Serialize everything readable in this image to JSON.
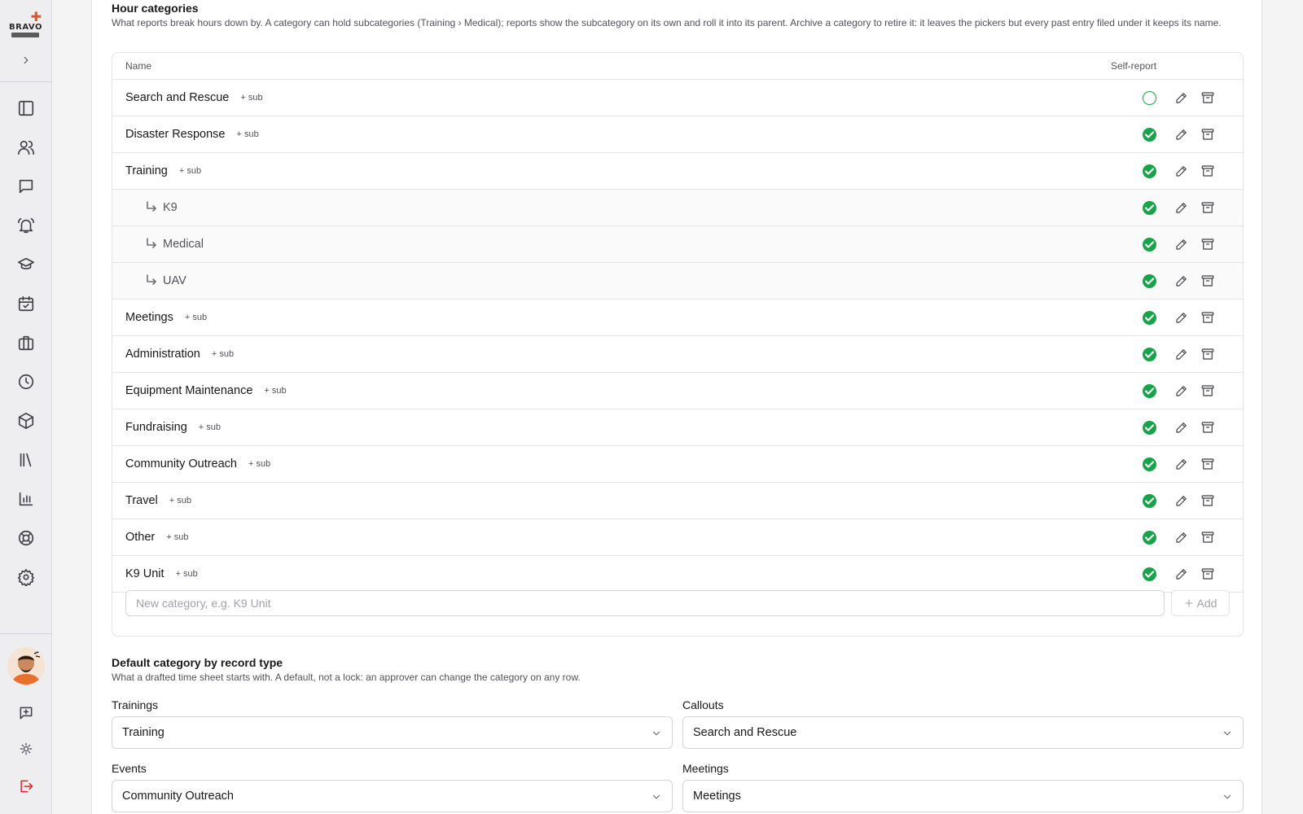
{
  "sidebar": {
    "logo_text": "BRAVO",
    "nav_icons": [
      "sidebar-panel-icon",
      "users-icon",
      "chat-icon",
      "bell-ring-icon",
      "graduation-cap-icon",
      "calendar-check-icon",
      "briefcase-icon",
      "clock-icon",
      "package-icon",
      "library-icon",
      "bar-chart-icon",
      "lifebuoy-icon",
      "gear-icon"
    ],
    "footer_icons": [
      "message-plus-icon",
      "sun-icon",
      "logout-icon"
    ]
  },
  "hour_categories": {
    "title": "Hour categories",
    "description": "What reports break hours down by. A category can hold subcategories (Training › Medical); reports show the subcategory on its own and roll it into its parent. Archive a category to retire it: it leaves the pickers but every past entry filed under it keeps its name.",
    "columns": {
      "name": "Name",
      "self_report": "Self-report"
    },
    "add_sub_label": "+ sub",
    "rows": [
      {
        "name": "Search and Rescue",
        "sub": false,
        "self_report": false
      },
      {
        "name": "Disaster Response",
        "sub": false,
        "self_report": true
      },
      {
        "name": "Training",
        "sub": false,
        "self_report": true
      },
      {
        "name": "K9",
        "sub": true,
        "self_report": true
      },
      {
        "name": "Medical",
        "sub": true,
        "self_report": true
      },
      {
        "name": "UAV",
        "sub": true,
        "self_report": true
      },
      {
        "name": "Meetings",
        "sub": false,
        "self_report": true
      },
      {
        "name": "Administration",
        "sub": false,
        "self_report": true
      },
      {
        "name": "Equipment Maintenance",
        "sub": false,
        "self_report": true
      },
      {
        "name": "Fundraising",
        "sub": false,
        "self_report": true
      },
      {
        "name": "Community Outreach",
        "sub": false,
        "self_report": true
      },
      {
        "name": "Travel",
        "sub": false,
        "self_report": true
      },
      {
        "name": "Other",
        "sub": false,
        "self_report": true
      },
      {
        "name": "K9 Unit",
        "sub": false,
        "self_report": true
      }
    ],
    "new_category_placeholder": "New category, e.g. K9 Unit",
    "new_category_value": "",
    "add_button_label": "Add"
  },
  "defaults": {
    "title": "Default category by record type",
    "description": "What a drafted time sheet starts with. A default, not a lock: an approver can change the category on any row.",
    "fields": [
      {
        "label": "Trainings",
        "value": "Training"
      },
      {
        "label": "Callouts",
        "value": "Search and Rescue"
      },
      {
        "label": "Events",
        "value": "Community Outreach"
      },
      {
        "label": "Meetings",
        "value": "Meetings"
      }
    ]
  },
  "colors": {
    "check_green": "#16a34a",
    "accent_logout": "#dc2626",
    "logo_cross": "#e2552a"
  }
}
